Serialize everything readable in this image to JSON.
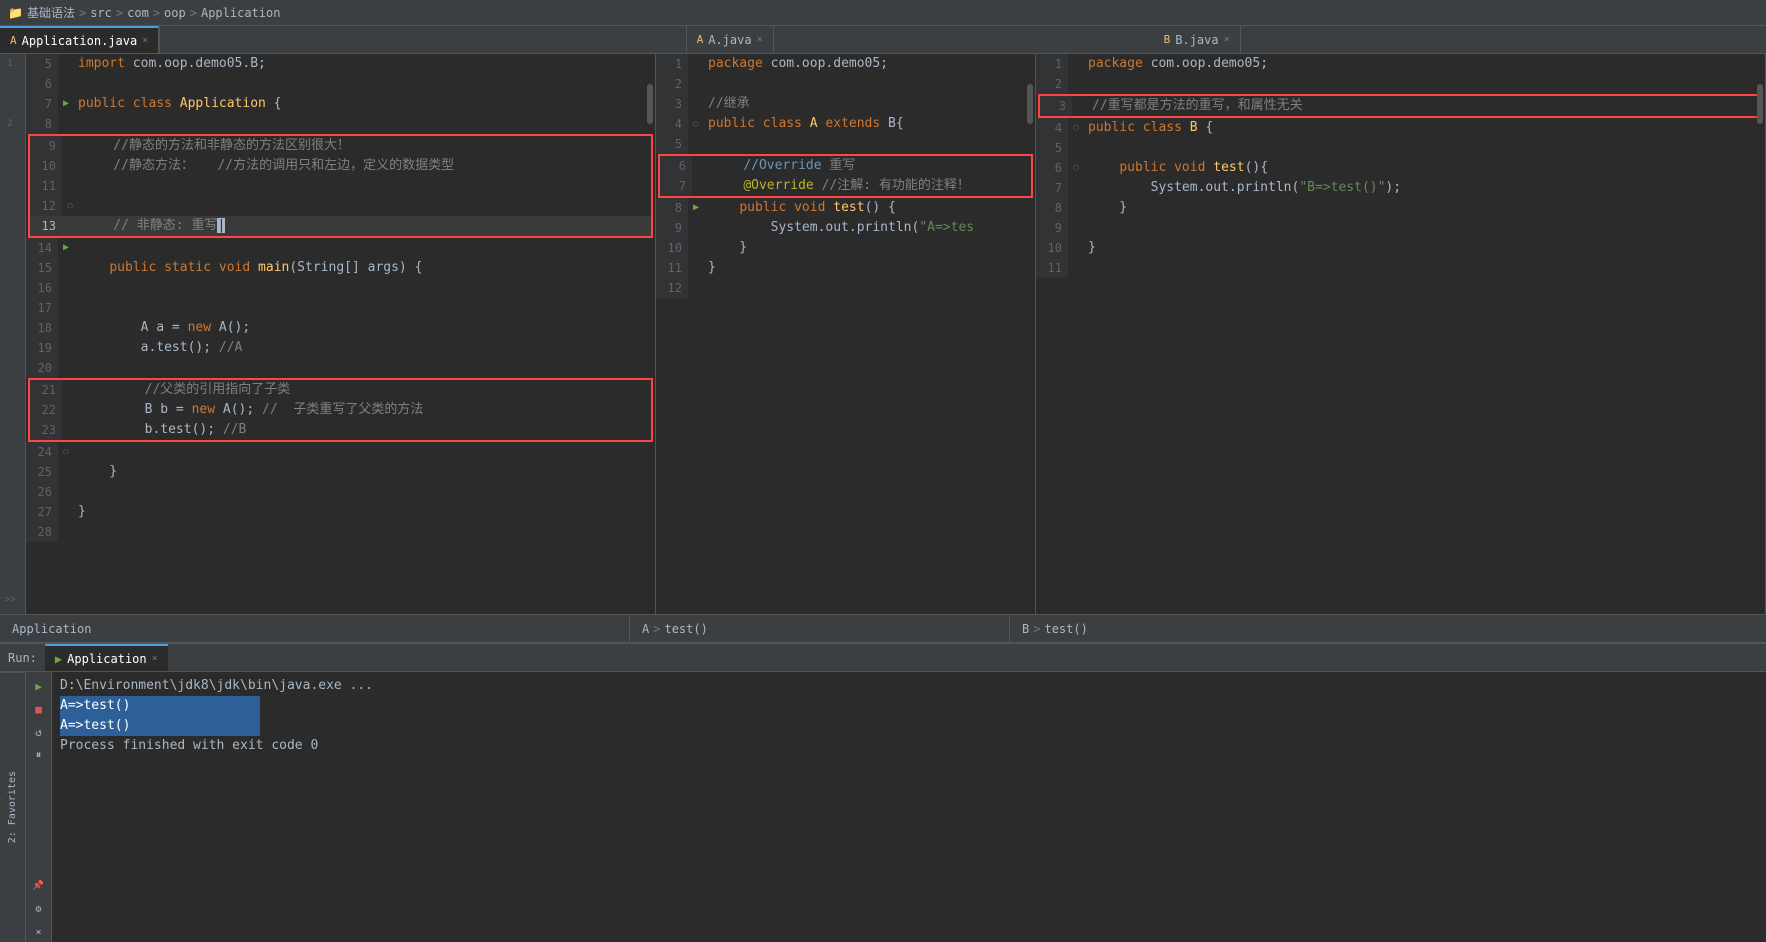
{
  "breadcrumb": {
    "items": [
      "基础语法",
      "src",
      "com",
      "oop",
      "Application"
    ],
    "separators": [
      ">",
      ">",
      ">",
      ">"
    ]
  },
  "tabs": {
    "main": {
      "label": "Application.java",
      "active": true,
      "icon": "A"
    },
    "secondary": {
      "label": "A.java",
      "active": false,
      "icon": "A"
    },
    "tertiary": {
      "label": "B.java",
      "active": false,
      "icon": "B"
    }
  },
  "editor_main": {
    "lines": [
      {
        "num": 5,
        "code": "import com.oop.demo05.B;"
      },
      {
        "num": 6,
        "code": ""
      },
      {
        "num": 7,
        "code": "public class Application {"
      },
      {
        "num": 8,
        "code": ""
      },
      {
        "num": 9,
        "code": "    //静态的方法和非静态的方法区别很大！"
      },
      {
        "num": 10,
        "code": "    //静态方法：   //方法的调用只和左边，定义的数据类型"
      },
      {
        "num": 11,
        "code": ""
      },
      {
        "num": 12,
        "code": ""
      },
      {
        "num": 13,
        "code": "    // 非静态: 重写",
        "cursor": true
      },
      {
        "num": 14,
        "code": ""
      },
      {
        "num": 15,
        "code": "    public static void main(String[] args) {"
      },
      {
        "num": 16,
        "code": ""
      },
      {
        "num": 17,
        "code": ""
      },
      {
        "num": 18,
        "code": "        A a = new A();"
      },
      {
        "num": 19,
        "code": "        a.test(); //A"
      },
      {
        "num": 20,
        "code": ""
      },
      {
        "num": 21,
        "code": "        //父类的引用指向了子类"
      },
      {
        "num": 22,
        "code": "        B b = new A(); //  子类重写了父类的方法"
      },
      {
        "num": 23,
        "code": "        b.test(); //B"
      },
      {
        "num": 24,
        "code": ""
      },
      {
        "num": 25,
        "code": "    }"
      },
      {
        "num": 26,
        "code": ""
      },
      {
        "num": 27,
        "code": "}"
      },
      {
        "num": 28,
        "code": ""
      }
    ],
    "status": "Application"
  },
  "editor_a": {
    "lines": [
      {
        "num": 1,
        "code": "package com.oop.demo05;"
      },
      {
        "num": 2,
        "code": ""
      },
      {
        "num": 3,
        "code": "//继承"
      },
      {
        "num": 4,
        "code": "public class A extends B{"
      },
      {
        "num": 5,
        "code": ""
      },
      {
        "num": 6,
        "code": "    //Override 重写"
      },
      {
        "num": 7,
        "code": "    @Override //注解: 有功能的注释！"
      },
      {
        "num": 8,
        "code": "    public void test() {"
      },
      {
        "num": 9,
        "code": "        System.out.println(\"A=>tes"
      },
      {
        "num": 10,
        "code": "    }"
      },
      {
        "num": 11,
        "code": "}"
      },
      {
        "num": 12,
        "code": ""
      }
    ],
    "status_breadcrumb": [
      "A",
      "test()"
    ]
  },
  "editor_b": {
    "lines": [
      {
        "num": 1,
        "code": "package com.oop.demo05;"
      },
      {
        "num": 2,
        "code": ""
      },
      {
        "num": 3,
        "code": "//重写都是方法的重写，和属性无关"
      },
      {
        "num": 4,
        "code": "public class B {"
      },
      {
        "num": 5,
        "code": ""
      },
      {
        "num": 6,
        "code": "    public void test(){"
      },
      {
        "num": 7,
        "code": "        System.out.println(\"B=>test()\");"
      },
      {
        "num": 8,
        "code": "    }"
      },
      {
        "num": 9,
        "code": ""
      },
      {
        "num": 10,
        "code": "}"
      },
      {
        "num": 11,
        "code": ""
      }
    ],
    "status_breadcrumb": [
      "B",
      "test()"
    ]
  },
  "run_panel": {
    "tab_label": "Run:",
    "tab_name": "Application",
    "output_lines": [
      {
        "type": "cmd",
        "text": "D:\\Environment\\jdk8\\jdk\\bin\\java.exe ..."
      },
      {
        "type": "result-selected",
        "text": "A=>test()"
      },
      {
        "type": "result-selected2",
        "text": "A=>test()"
      },
      {
        "type": "empty",
        "text": ""
      },
      {
        "type": "process",
        "text": "Process finished with exit code 0"
      }
    ]
  },
  "icons": {
    "play": "▶",
    "stop": "■",
    "pause": "⏸",
    "rerun": "↺",
    "close": "×",
    "chevron": ">",
    "folder": "📁",
    "java_file": "☕",
    "down_arrow": "▼"
  }
}
